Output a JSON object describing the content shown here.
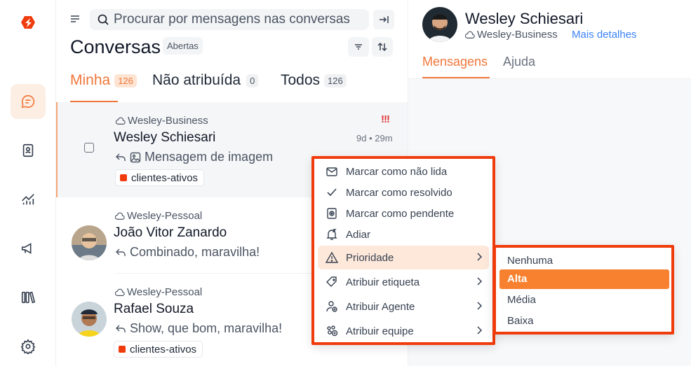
{
  "rail": {
    "logo": "chatwoot-logo-icon",
    "items": [
      "conversations-icon",
      "contacts-icon",
      "reports-icon",
      "campaigns-icon",
      "library-icon",
      "settings-icon"
    ]
  },
  "conversations": {
    "search_placeholder": "Procurar por mensagens nas conversas",
    "title": "Conversas",
    "status_badge": "Abertas",
    "tabs": [
      {
        "label": "Minha",
        "count": "126"
      },
      {
        "label": "Não atribuída",
        "count": "0"
      },
      {
        "label": "Todos",
        "count": "126"
      }
    ],
    "items": [
      {
        "inbox": "Wesley-Business",
        "name": "Wesley Schiesari",
        "time": "9d • 29m",
        "preview": "Mensagem de imagem",
        "label": "clientes-ativos",
        "priority": "!!!"
      },
      {
        "inbox": "Wesley-Pessoal",
        "name": "João Vitor Zanardo",
        "preview": "Combinado, maravilha!"
      },
      {
        "inbox": "Wesley-Pessoal",
        "name": "Rafael Souza",
        "preview": "Show, que bom, maravilha!",
        "label": "clientes-ativos"
      }
    ]
  },
  "detail": {
    "name": "Wesley Schiesari",
    "inbox": "Wesley-Business",
    "more_link": "Mais detalhes",
    "tabs": [
      "Mensagens",
      "Ajuda"
    ]
  },
  "context_menu": {
    "items": [
      {
        "label": "Marcar como não lida",
        "icon": "mail-icon"
      },
      {
        "label": "Marcar como resolvido",
        "icon": "check-icon"
      },
      {
        "label": "Marcar como pendente",
        "icon": "pending-icon"
      },
      {
        "label": "Adiar",
        "icon": "snooze-icon"
      },
      {
        "label": "Prioridade",
        "icon": "warning-icon"
      },
      {
        "label": "Atribuir etiqueta",
        "icon": "tag-icon"
      },
      {
        "label": "Atribuir Agente",
        "icon": "agent-icon"
      },
      {
        "label": "Atribuir equipe",
        "icon": "team-icon"
      }
    ],
    "priority_submenu": {
      "options": [
        "Nenhuma",
        "Alta",
        "Média",
        "Baixa"
      ],
      "selected": "Alta"
    }
  },
  "colors": {
    "accent": "#f0773a",
    "highlight_border": "#f03c0c",
    "label_dot": "#f03c0c",
    "link": "#3b82f6"
  }
}
